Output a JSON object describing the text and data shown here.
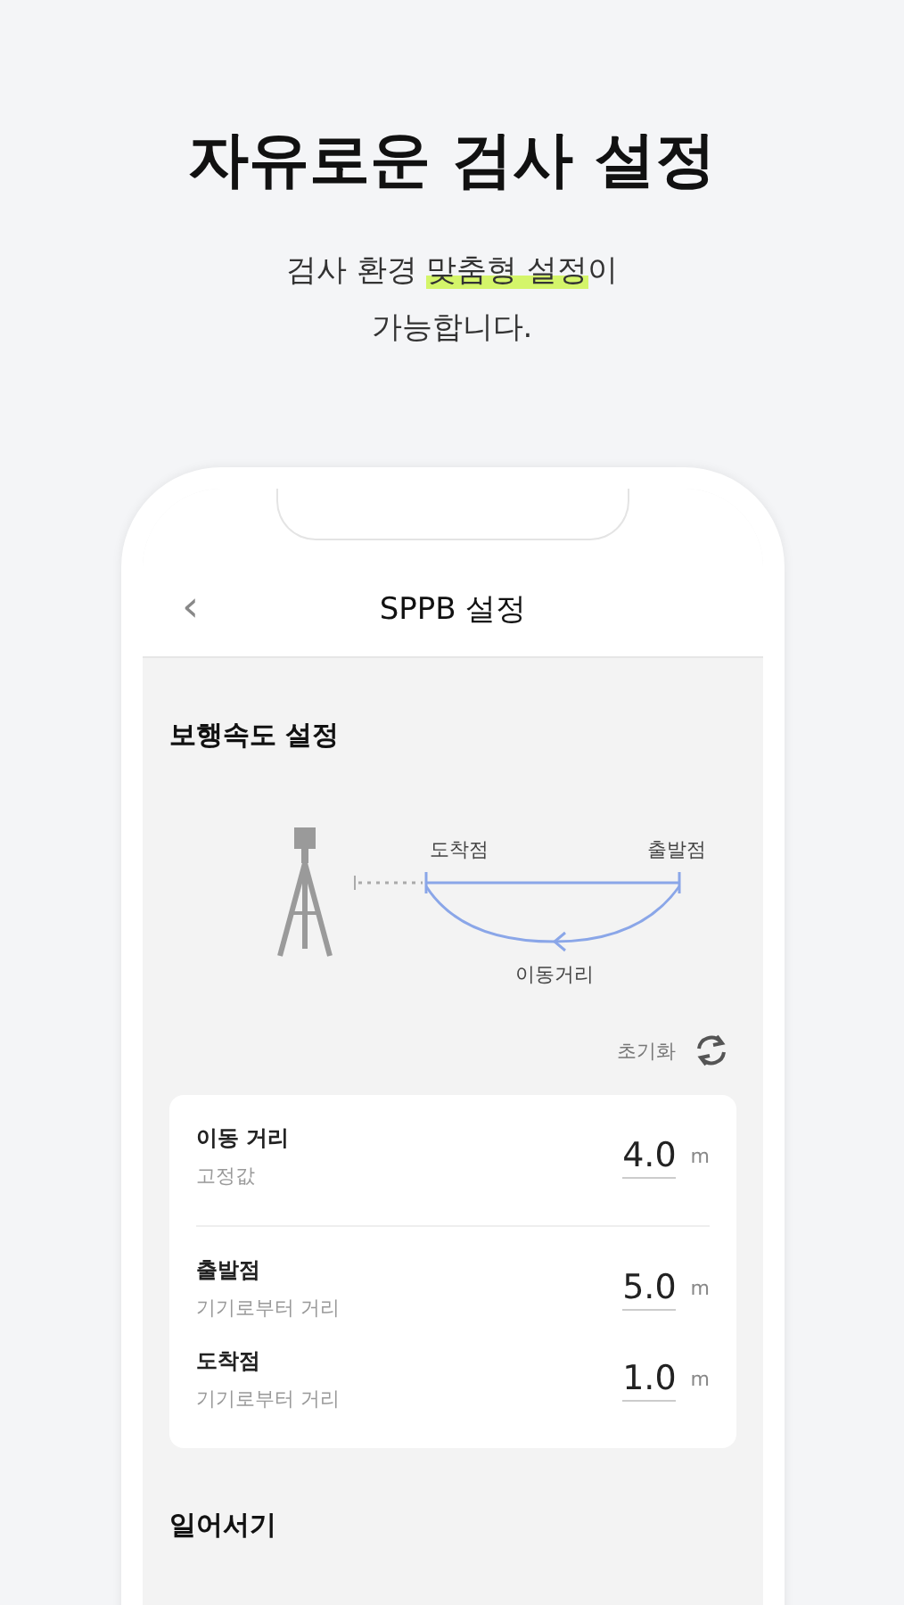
{
  "heading": "자유로운 검사 설정",
  "subtitle": {
    "lines": [
      [
        {
          "text": "검사 환경 ",
          "highlighted": false
        },
        {
          "text": "맞춤형 설정",
          "highlighted": true
        },
        {
          "text": "이",
          "highlighted": false
        }
      ],
      [
        {
          "text": "가능합니다.",
          "highlighted": false
        }
      ]
    ]
  },
  "screen": {
    "back_icon": "‹",
    "title": "SPPB 설정",
    "sections": [
      {
        "title": "보행속도 설정",
        "diagram": {
          "end_label": "도착점",
          "start_label": "출발점",
          "path_label": "이동거리"
        },
        "reset_label": "초기화",
        "groups": [
          [
            {
              "label": "이동 거리",
              "sublabel": "고정값",
              "value": "4.0",
              "unit": "m"
            }
          ],
          [
            {
              "label": "출발점",
              "sublabel": "기기로부터 거리",
              "value": "5.0",
              "unit": "m"
            },
            {
              "label": "도착점",
              "sublabel": "기기로부터 거리",
              "value": "1.0",
              "unit": "m"
            }
          ]
        ]
      },
      {
        "title": "일어서기"
      }
    ]
  }
}
